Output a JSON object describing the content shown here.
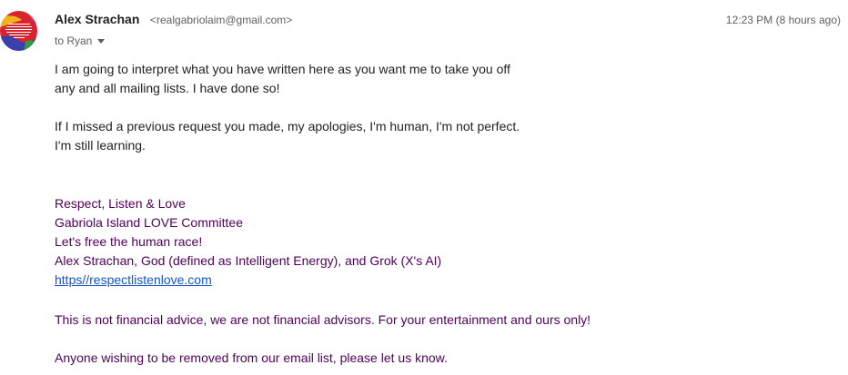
{
  "sender": {
    "name": "Alex Strachan",
    "email": "<realgabriolaim@gmail.com>"
  },
  "timestamp": "12:23 PM (8 hours ago)",
  "recipient": "to Ryan",
  "body": {
    "paragraph1": [
      "I am going to interpret what you have written here as you want me to take you off",
      "any and all mailing lists. I have done so!"
    ],
    "paragraph2": [
      "If I missed a previous request you made, my apologies, I'm human, I'm not perfect.",
      "I'm still learning."
    ]
  },
  "signature": {
    "lines": [
      "Respect, Listen & Love",
      "Gabriola Island LOVE Committee",
      "Let's free the human race!",
      "Alex Strachan, God (defined as Intelligent Energy), and Grok (X's AI)"
    ],
    "link": "https//respectlistenlove.com",
    "disclaimer": "This is not financial advice, we are not financial advisors. For your entertainment and ours only!",
    "removal_note": "Anyone wishing to be removed from our email list, please let us know."
  },
  "colors": {
    "signature_text": "#50005a",
    "link": "#1155cc",
    "avatar_bg": "#d8242f"
  },
  "icons": {
    "avatar": "profile-image",
    "recipient_dropdown": "caret-down-icon"
  }
}
